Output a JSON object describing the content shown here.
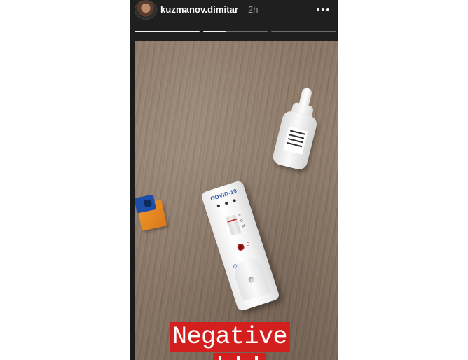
{
  "story": {
    "username": "kuzmanov.dimitar",
    "time": "2h",
    "progress_fill": [
      1.0,
      0.35,
      0.0
    ],
    "sticker_text": "Negative"
  },
  "photo": {
    "cassette_brand": "COVID-19",
    "cassette_marks": "C\nG\nM",
    "cassette_sample_mark": "S",
    "cassette_id_label": "ID"
  },
  "icons": {
    "avatar": "avatar",
    "more": "more-dots-icon"
  },
  "colors": {
    "sticker_bg": "#d41f1f",
    "header_bg": "#1f1f1f",
    "progress_active": "#f4f4f4",
    "progress_inactive": "#6c6c6c"
  }
}
